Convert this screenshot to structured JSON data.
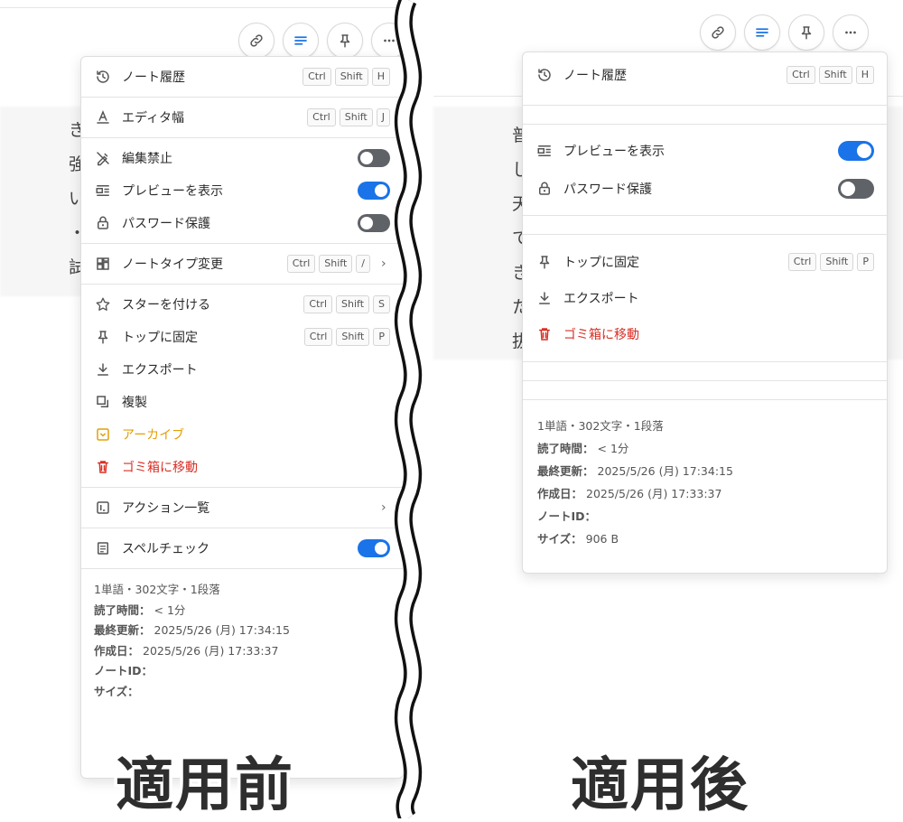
{
  "colors": {
    "accent": "#1a73e8",
    "archive": "#e3a008",
    "danger": "#d93025",
    "toggle_off": "#5f6368"
  },
  "toolbar_icons": [
    "link-icon",
    "list-icon",
    "pin-icon",
    "more-icon"
  ],
  "bg_text_left": [
    "き",
    "強",
    "い",
    "・",
    "試"
  ],
  "bg_text_right": [
    "普",
    "し",
    "天",
    "て",
    "き",
    "た",
    "抜"
  ],
  "before": {
    "caption": "適用前",
    "sec1": [
      {
        "label": "ノート履歴",
        "keys": [
          "Ctrl",
          "Shift",
          "H"
        ]
      }
    ],
    "sec2": [
      {
        "label": "エディタ幅",
        "keys": [
          "Ctrl",
          "Shift",
          "J"
        ]
      }
    ],
    "sec3": [
      {
        "label": "編集禁止"
      },
      {
        "label": "プレビューを表示"
      },
      {
        "label": "パスワード保護"
      }
    ],
    "sec4": [
      {
        "label": "ノートタイプ変更",
        "keys": [
          "Ctrl",
          "Shift",
          "/"
        ]
      }
    ],
    "sec5": [
      {
        "label": "スターを付ける",
        "keys": [
          "Ctrl",
          "Shift",
          "S"
        ]
      },
      {
        "label": "トップに固定",
        "keys": [
          "Ctrl",
          "Shift",
          "P"
        ]
      },
      {
        "label": "エクスポート"
      },
      {
        "label": "複製"
      },
      {
        "label": "アーカイブ"
      },
      {
        "label": "ゴミ箱に移動"
      }
    ],
    "sec6": [
      {
        "label": "アクション一覧"
      }
    ],
    "sec7": [
      {
        "label": "スペルチェック"
      }
    ],
    "info": {
      "stats": "1単語・302文字・1段落",
      "read_label": "読了時間：",
      "read_value": "< 1分",
      "updated_label": "最終更新：",
      "updated_value": "2025/5/26 (月) 17:34:15",
      "created_label": "作成日：",
      "created_value": "2025/5/26 (月) 17:33:37",
      "id_label": "ノートID：",
      "size_label": "サイズ："
    }
  },
  "after": {
    "caption": "適用後",
    "sec1": [
      {
        "label": "ノート履歴",
        "keys": [
          "Ctrl",
          "Shift",
          "H"
        ]
      }
    ],
    "sec2": [
      {
        "label": "プレビューを表示"
      },
      {
        "label": "パスワード保護"
      }
    ],
    "sec3": [
      {
        "label": "トップに固定",
        "keys": [
          "Ctrl",
          "Shift",
          "P"
        ]
      },
      {
        "label": "エクスポート"
      },
      {
        "label": "ゴミ箱に移動"
      }
    ],
    "info": {
      "stats": "1単語・302文字・1段落",
      "read_label": "読了時間：",
      "read_value": "< 1分",
      "updated_label": "最終更新：",
      "updated_value": "2025/5/26 (月) 17:34:15",
      "created_label": "作成日：",
      "created_value": "2025/5/26 (月) 17:33:37",
      "id_label": "ノートID：",
      "size_label": "サイズ：",
      "size_value": "906 B"
    }
  },
  "toggles": {
    "before_edit_lock": false,
    "before_preview": true,
    "before_password": false,
    "before_spellcheck": true,
    "after_preview": true,
    "after_password": false
  }
}
